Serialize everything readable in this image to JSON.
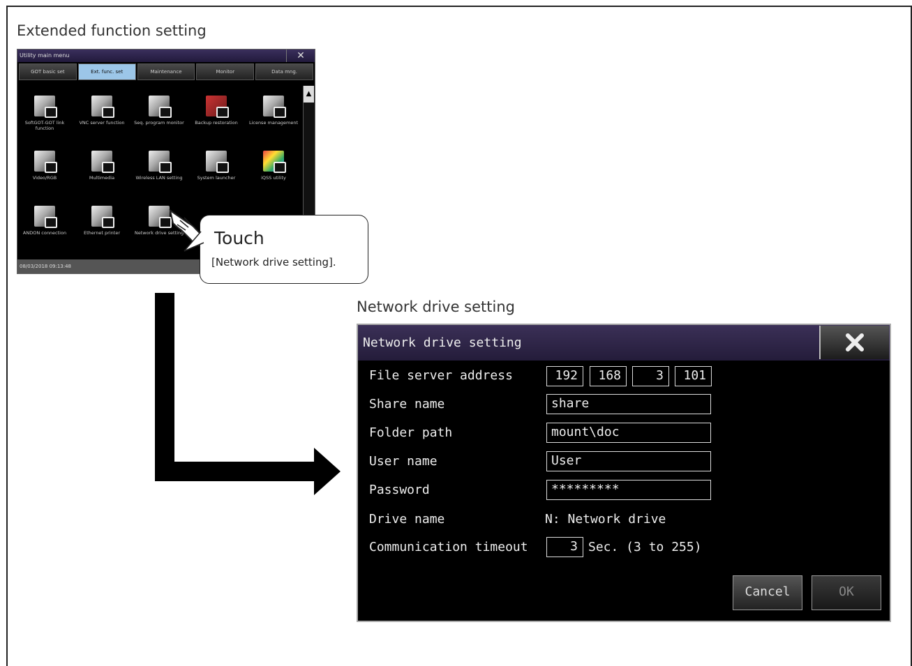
{
  "sections": {
    "top_title": "Extended function setting",
    "bottom_title": "Network drive setting"
  },
  "utility_menu": {
    "title": "Utility main menu",
    "tabs": [
      {
        "label": "GOT basic set",
        "active": false
      },
      {
        "label": "Ext. func. set",
        "active": true
      },
      {
        "label": "Maintenance",
        "active": false
      },
      {
        "label": "Monitor",
        "active": false
      },
      {
        "label": "Data mng.",
        "active": false
      }
    ],
    "icons": [
      {
        "label": "SoftGOT-GOT link function",
        "icon": "softgot-link-icon"
      },
      {
        "label": "VNC server function",
        "icon": "vnc-server-icon"
      },
      {
        "label": "Seq. program monitor",
        "icon": "sequence-monitor-icon"
      },
      {
        "label": "Backup restoration",
        "icon": "backup-restore-icon"
      },
      {
        "label": "License management",
        "icon": "license-icon"
      },
      {
        "label": "Video/RGB",
        "icon": "video-rgb-icon"
      },
      {
        "label": "Multimedia",
        "icon": "multimedia-icon"
      },
      {
        "label": "Wireless LAN setting",
        "icon": "wireless-lan-icon"
      },
      {
        "label": "System launcher",
        "icon": "system-launcher-icon"
      },
      {
        "label": "iQSS utility",
        "icon": "iqss-utility-icon"
      },
      {
        "label": "ANDON connection",
        "icon": "andon-icon"
      },
      {
        "label": "Ethernet printer",
        "icon": "ethernet-printer-icon"
      },
      {
        "label": "Network drive setting",
        "icon": "network-drive-icon"
      }
    ],
    "status_datetime": "08/03/2018 09:13:48"
  },
  "callout": {
    "title": "Touch",
    "subtitle": "[Network drive setting]."
  },
  "dialog": {
    "title": "Network drive setting",
    "file_server_label": "File server address",
    "ip": [
      "192",
      "168",
      "3",
      "101"
    ],
    "share_label": "Share name",
    "share_value": "share",
    "folder_label": "Folder path",
    "folder_value": "mount\\doc",
    "user_label": "User name",
    "user_value": "User",
    "password_label": "Password",
    "password_value": "*********",
    "drive_label": "Drive name",
    "drive_value": "N: Network drive",
    "timeout_label": "Communication timeout",
    "timeout_value": "3",
    "timeout_unit": "Sec. (3 to 255)",
    "cancel_label": "Cancel",
    "ok_label": "OK"
  }
}
